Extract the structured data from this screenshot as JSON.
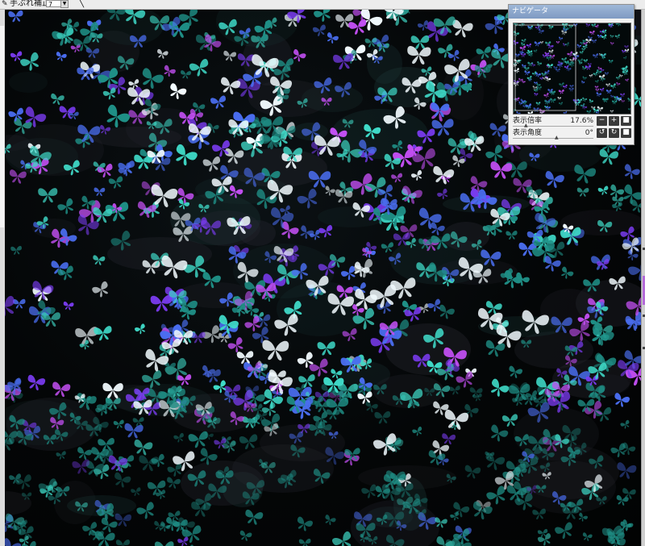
{
  "toolbar": {
    "stabilization_label": "手ぶれ補正",
    "stabilization_value": "7",
    "dropdown_arrow": "▼",
    "stabilization_icon": "pen-icon",
    "tool_icon": "line-tool-icon"
  },
  "navigator": {
    "title": "ナビゲータ",
    "zoom_label": "表示倍率",
    "zoom_value": "17.6%",
    "angle_label": "表示角度",
    "angle_value": "0°",
    "buttons": {
      "zoom_out": "minus-icon",
      "zoom_in": "plus-icon",
      "fit": "fit-square-icon",
      "rotate_left": "rotate-left-icon",
      "rotate_right": "rotate-right-icon",
      "reset": "reset-square-icon"
    }
  },
  "canvas": {
    "content": "butterfly-swarm-artwork",
    "colors": {
      "background": "#030506",
      "cyan": "#3fd9c7",
      "teal": "#1f8f86",
      "blue": "#4a6ef0",
      "violet": "#7b3cf2",
      "magenta": "#c24ff2",
      "white": "#f2fbff"
    }
  }
}
